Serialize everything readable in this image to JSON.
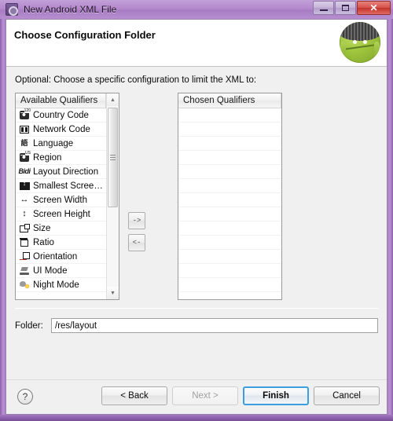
{
  "window": {
    "title": "New Android XML File",
    "icon": "android-settings-icon",
    "controls": {
      "minimize": "minimize-icon",
      "maximize": "maximize-icon",
      "close": "✕"
    }
  },
  "header": {
    "title": "Choose Configuration Folder",
    "logo": "android-robot-logo"
  },
  "body": {
    "instruction": "Optional: Choose a specific configuration to limit the XML to:",
    "available": {
      "header": "Available Qualifiers",
      "items": [
        {
          "label": "Country Code",
          "icon": "country-code-icon"
        },
        {
          "label": "Network Code",
          "icon": "network-code-icon"
        },
        {
          "label": "Language",
          "icon": "language-icon"
        },
        {
          "label": "Region",
          "icon": "region-icon"
        },
        {
          "label": "Layout Direction",
          "icon": "layout-direction-icon"
        },
        {
          "label": "Smallest Screen...",
          "icon": "smallest-screen-icon"
        },
        {
          "label": "Screen Width",
          "icon": "screen-width-icon"
        },
        {
          "label": "Screen Height",
          "icon": "screen-height-icon"
        },
        {
          "label": "Size",
          "icon": "size-icon"
        },
        {
          "label": "Ratio",
          "icon": "ratio-icon"
        },
        {
          "label": "Orientation",
          "icon": "orientation-icon"
        },
        {
          "label": "UI Mode",
          "icon": "ui-mode-icon"
        },
        {
          "label": "Night Mode",
          "icon": "night-mode-icon"
        }
      ]
    },
    "transfer": {
      "add_label": "->",
      "remove_label": "<-"
    },
    "chosen": {
      "header": "Chosen Qualifiers",
      "items": [],
      "empty_row_count": 14
    },
    "folder": {
      "label": "Folder:",
      "value": "/res/layout",
      "placeholder": ""
    }
  },
  "footer": {
    "help_label": "?",
    "back_label": "< Back",
    "next_label": "Next >",
    "finish_label": "Finish",
    "cancel_label": "Cancel"
  },
  "colors": {
    "frame": "#a97fc4",
    "default_button_border": "#3c9ede",
    "client_bg": "#f0f0f0"
  }
}
